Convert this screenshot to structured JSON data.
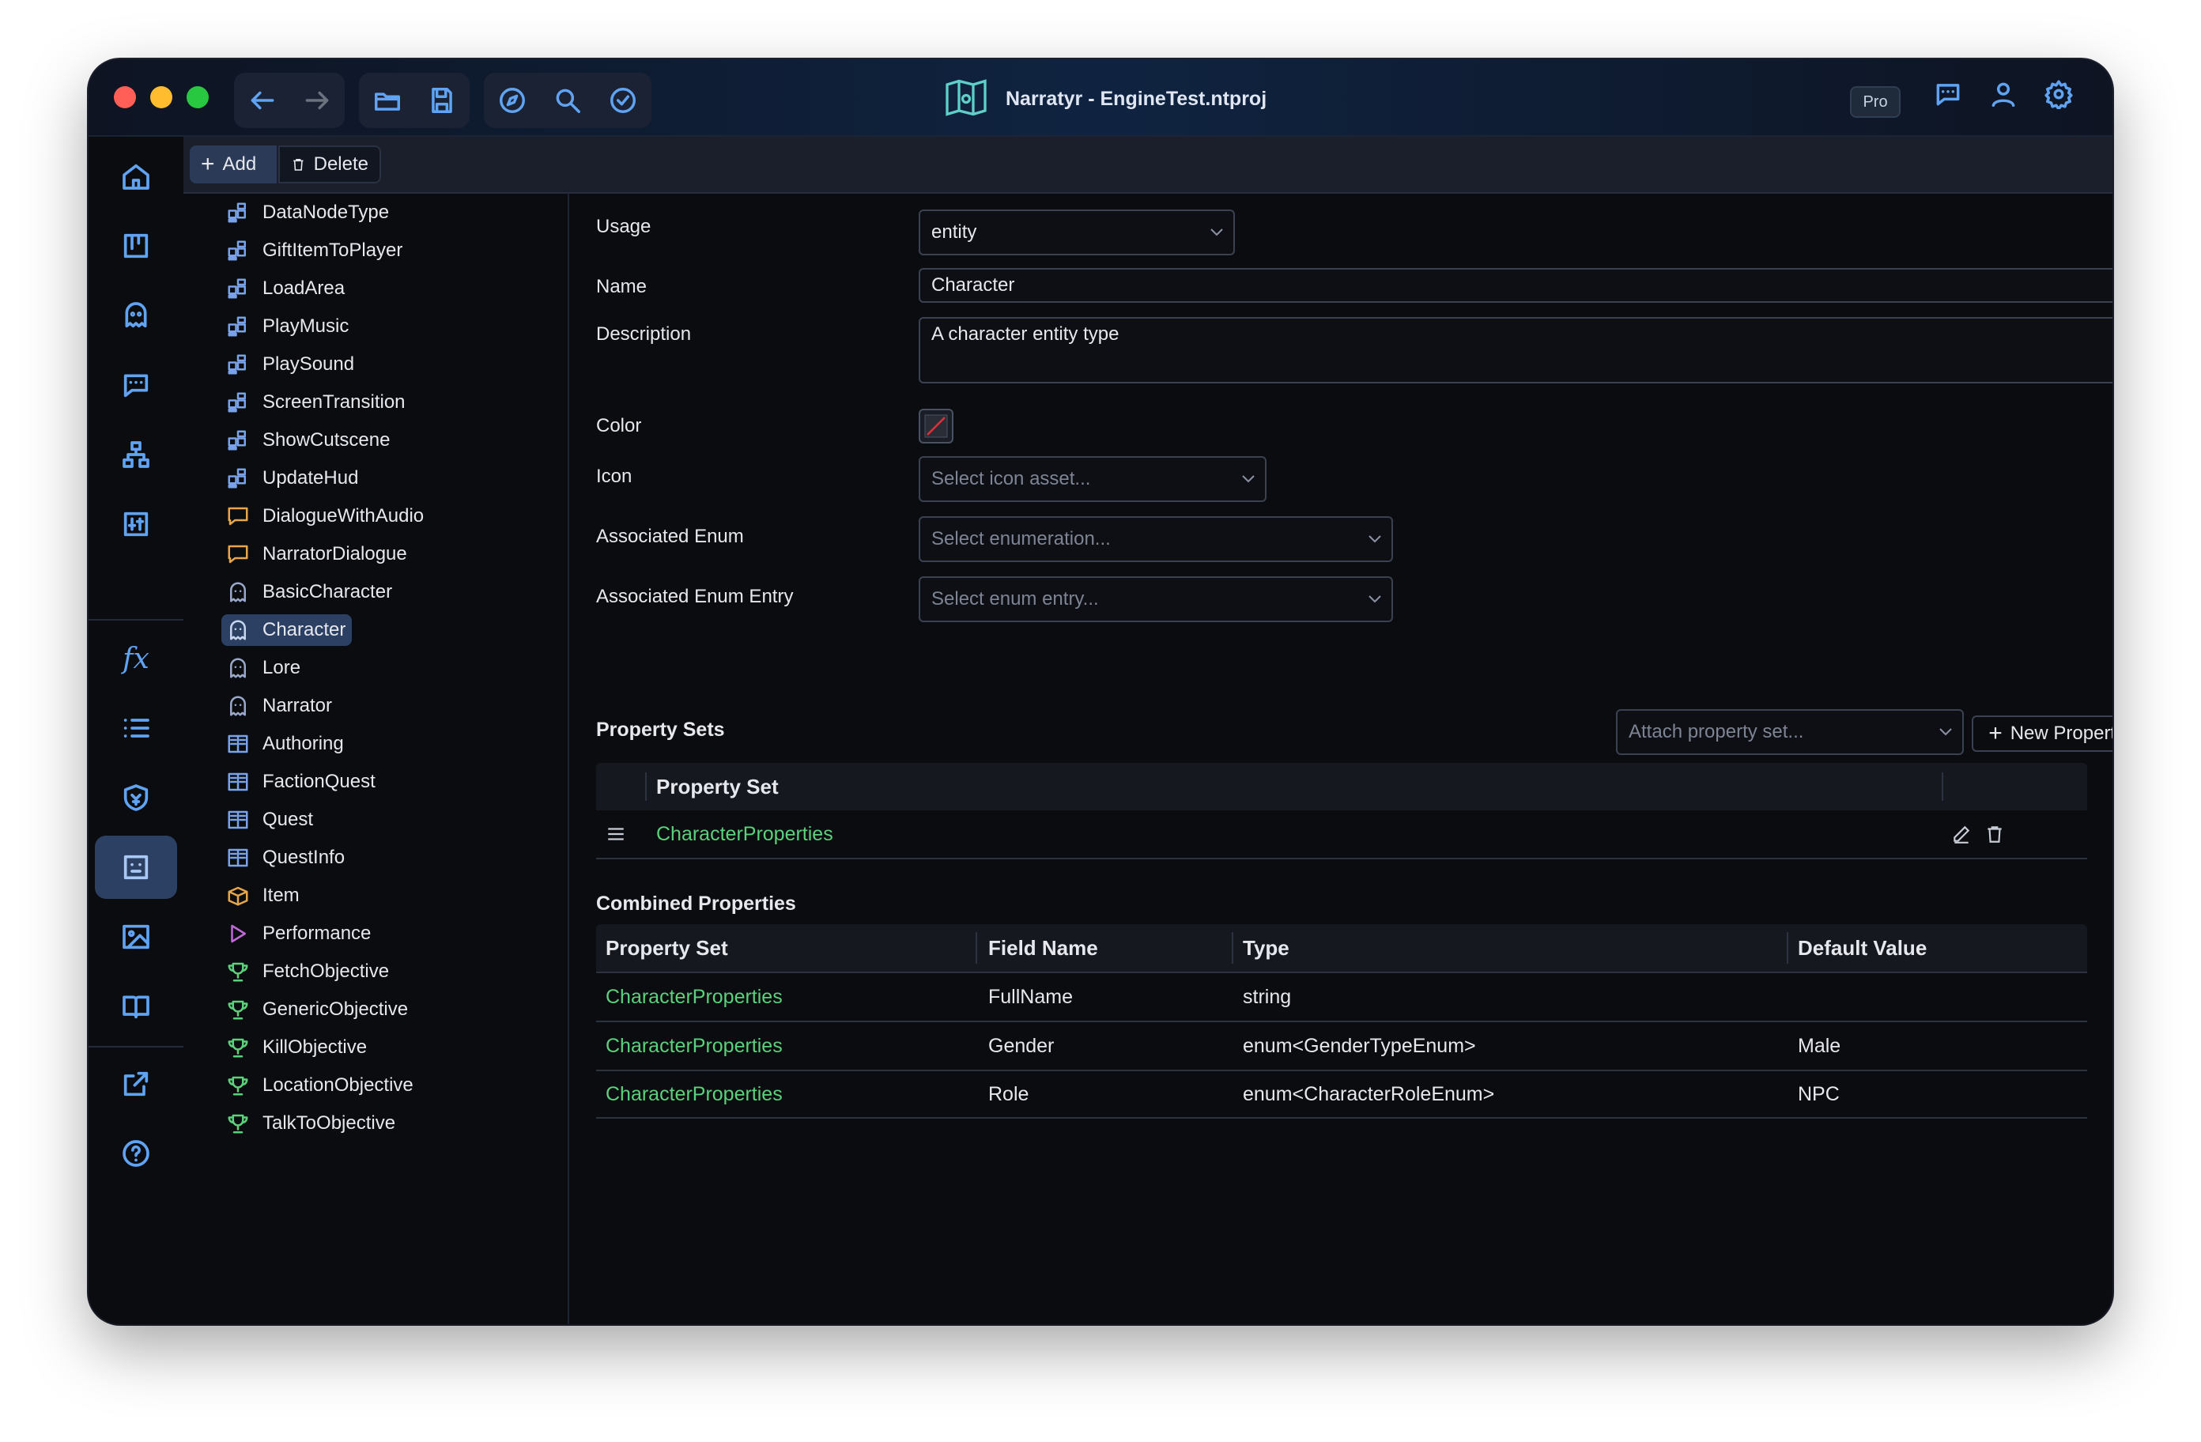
{
  "window": {
    "title": "Narratyr - EngineTest.ntproj",
    "badge": "Pro"
  },
  "toolbar": {
    "add_label": "Add",
    "delete_label": "Delete"
  },
  "tree": {
    "items": [
      {
        "label": "DataNodeType",
        "icon": "node-icon",
        "color": "#7aa2e8"
      },
      {
        "label": "GiftItemToPlayer",
        "icon": "node-icon",
        "color": "#7aa2e8"
      },
      {
        "label": "LoadArea",
        "icon": "node-icon",
        "color": "#7aa2e8"
      },
      {
        "label": "PlayMusic",
        "icon": "node-icon",
        "color": "#7aa2e8"
      },
      {
        "label": "PlaySound",
        "icon": "node-icon",
        "color": "#7aa2e8"
      },
      {
        "label": "ScreenTransition",
        "icon": "node-icon",
        "color": "#7aa2e8"
      },
      {
        "label": "ShowCutscene",
        "icon": "node-icon",
        "color": "#7aa2e8"
      },
      {
        "label": "UpdateHud",
        "icon": "node-icon",
        "color": "#7aa2e8"
      },
      {
        "label": "DialogueWithAudio",
        "icon": "speech-bubble-icon",
        "color": "#e7a64a"
      },
      {
        "label": "NarratorDialogue",
        "icon": "speech-bubble-icon",
        "color": "#e7a64a"
      },
      {
        "label": "BasicCharacter",
        "icon": "ghost-icon",
        "color": "#9aa7c8"
      },
      {
        "label": "Character",
        "icon": "ghost-icon",
        "color": "#c7d4ef"
      },
      {
        "label": "Lore",
        "icon": "ghost-icon",
        "color": "#9aa7c8"
      },
      {
        "label": "Narrator",
        "icon": "ghost-icon",
        "color": "#9aa7c8"
      },
      {
        "label": "Authoring",
        "icon": "book-icon",
        "color": "#7aa2e8"
      },
      {
        "label": "FactionQuest",
        "icon": "book-icon",
        "color": "#7aa2e8"
      },
      {
        "label": "Quest",
        "icon": "book-icon",
        "color": "#7aa2e8"
      },
      {
        "label": "QuestInfo",
        "icon": "book-icon",
        "color": "#7aa2e8"
      },
      {
        "label": "Item",
        "icon": "box-icon",
        "color": "#e7a64a"
      },
      {
        "label": "Performance",
        "icon": "play-icon",
        "color": "#c06ad6"
      },
      {
        "label": "FetchObjective",
        "icon": "trophy-icon",
        "color": "#5ad17a"
      },
      {
        "label": "GenericObjective",
        "icon": "trophy-icon",
        "color": "#5ad17a"
      },
      {
        "label": "KillObjective",
        "icon": "trophy-icon",
        "color": "#5ad17a"
      },
      {
        "label": "LocationObjective",
        "icon": "trophy-icon",
        "color": "#5ad17a"
      },
      {
        "label": "TalkToObjective",
        "icon": "trophy-icon",
        "color": "#5ad17a"
      }
    ],
    "selected": "Character"
  },
  "form": {
    "usage_label": "Usage",
    "usage_value": "entity",
    "name_label": "Name",
    "name_value": "Character",
    "description_label": "Description",
    "description_value": "A character entity type",
    "color_label": "Color",
    "icon_label": "Icon",
    "icon_placeholder": "Select icon asset...",
    "assoc_enum_label": "Associated Enum",
    "assoc_enum_placeholder": "Select enumeration...",
    "assoc_entry_label": "Associated Enum Entry",
    "assoc_entry_placeholder": "Select enum entry..."
  },
  "property_sets": {
    "title": "Property Sets",
    "attach_placeholder": "Attach property set...",
    "new_button": "New Property Set",
    "column": "Property Set",
    "rows": [
      {
        "name": "CharacterProperties"
      }
    ]
  },
  "combined": {
    "title": "Combined Properties",
    "columns": [
      "Property Set",
      "Field Name",
      "Type",
      "Default Value"
    ],
    "rows": [
      [
        "CharacterProperties",
        "FullName",
        "string",
        ""
      ],
      [
        "CharacterProperties",
        "Gender",
        "enum<GenderTypeEnum>",
        "Male"
      ],
      [
        "CharacterProperties",
        "Role",
        "enum<CharacterRoleEnum>",
        "NPC"
      ]
    ]
  },
  "colors": {
    "accent": "#5fa3f2",
    "link_green": "#5ad17a",
    "selected_bg": "#2c4063"
  }
}
